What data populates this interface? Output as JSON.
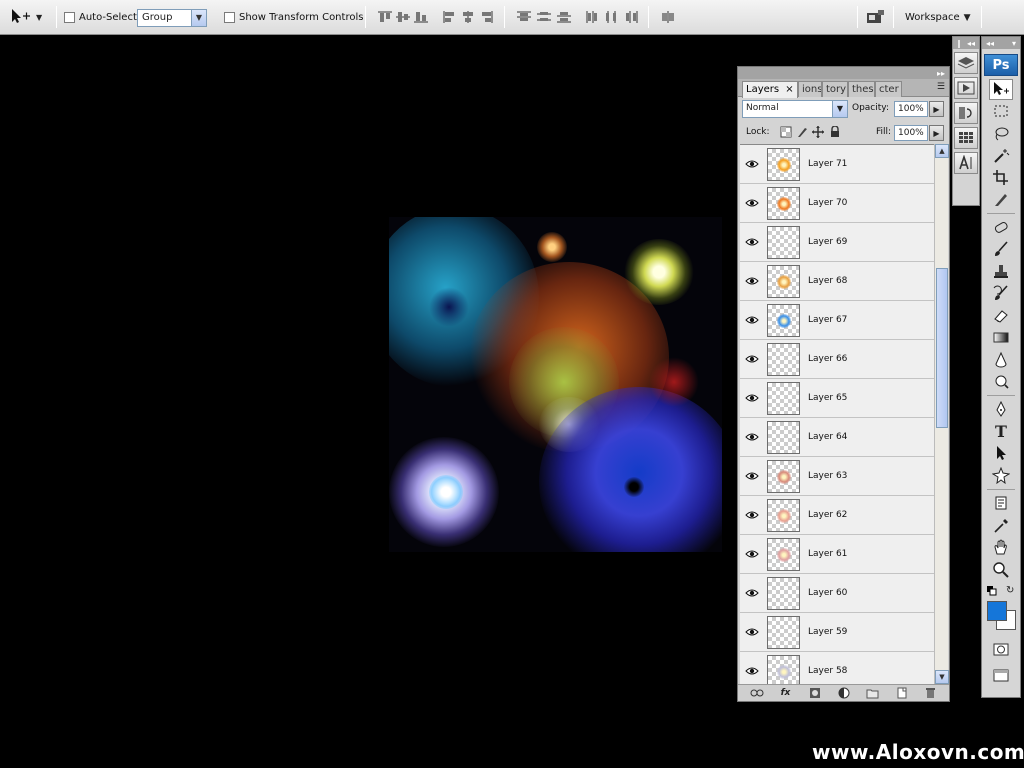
{
  "options_bar": {
    "auto_select_label": "Auto-Select:",
    "auto_select_value": "Group",
    "show_transform_label": "Show Transform Controls",
    "workspace_label": "Workspace"
  },
  "layers_panel": {
    "tabs": [
      {
        "label": "Layers",
        "active": true
      },
      {
        "label": "ions",
        "active": false
      },
      {
        "label": "tory",
        "active": false
      },
      {
        "label": "thes",
        "active": false
      },
      {
        "label": "cter",
        "active": false
      }
    ],
    "close_glyph": "×",
    "blend_mode": "Normal",
    "opacity_label": "Opacity:",
    "opacity_value": "100%",
    "lock_label": "Lock:",
    "fill_label": "Fill:",
    "fill_value": "100%",
    "layers": [
      {
        "name": "Layer 71",
        "thumb_color": "#f5a020"
      },
      {
        "name": "Layer 70",
        "thumb_color": "#f07a20"
      },
      {
        "name": "Layer 69",
        "thumb_color": ""
      },
      {
        "name": "Layer 68",
        "thumb_color": "#e8a040"
      },
      {
        "name": "Layer 67",
        "thumb_color": "#3a90e8"
      },
      {
        "name": "Layer 66",
        "thumb_color": ""
      },
      {
        "name": "Layer 65",
        "thumb_color": ""
      },
      {
        "name": "Layer 64",
        "thumb_color": ""
      },
      {
        "name": "Layer 63",
        "thumb_color": "#d88a7a"
      },
      {
        "name": "Layer 62",
        "thumb_color": "#e8a090"
      },
      {
        "name": "Layer 61",
        "thumb_color": "#e0a0a0"
      },
      {
        "name": "Layer 60",
        "thumb_color": ""
      },
      {
        "name": "Layer 59",
        "thumb_color": ""
      },
      {
        "name": "Layer 58",
        "thumb_color": "#c0c0d8"
      }
    ],
    "fx_label": "fx"
  },
  "tools_panel": {
    "logo": "Ps",
    "type_tool_glyph": "T",
    "foreground_color": "#1576d9",
    "background_color": "#ffffff"
  },
  "watermark": "www.Aloxovn.com"
}
